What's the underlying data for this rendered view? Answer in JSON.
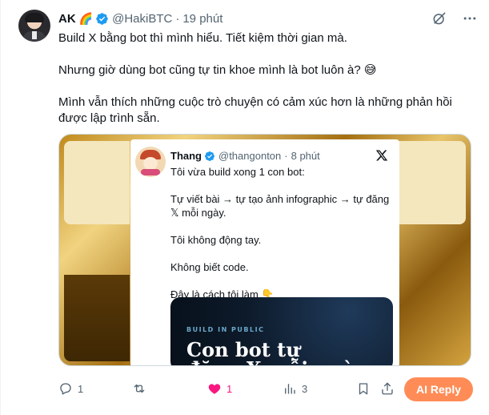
{
  "tweet": {
    "author_name": "AK",
    "author_emoji": "🌈",
    "handle": "@HakiBTC",
    "separator": "·",
    "time": "19 phút",
    "paragraphs": [
      "Build X bằng bot thì mình hiểu. Tiết kiệm thời gian mà.",
      "Nhưng giờ dùng bot cũng tự tin khoe mình là bot luôn à? 😅",
      "Mình vẫn thích những cuộc trò chuyện có cảm xúc hơn là những phản hồi được lập trình sẵn."
    ]
  },
  "quoted": {
    "author_name": "Thang",
    "handle": "@thangonton",
    "separator": "·",
    "time": "8 phút",
    "paragraphs": [
      "Tôi vừa build xong 1 con bot:",
      "Tự viết bài → tự tạo ảnh infographic → tự đăng 𝕏 mỗi ngày.",
      "Tôi không động tay.",
      "Không biết code.",
      "Đây là cách tôi làm 👇"
    ],
    "promo": {
      "eyebrow": "BUILD IN PUBLIC",
      "headline_line1": "Con bot tự",
      "headline_line2": "đăng X mỗi ngày"
    }
  },
  "actions": {
    "replies": "1",
    "reposts": "",
    "likes": "1",
    "views": "3",
    "ai_reply_label": "AI Reply"
  },
  "icons": {
    "grok": "grok-icon",
    "more": "more-icon",
    "verified": "verified-icon",
    "x_logo": "x-logo-icon",
    "reply": "reply-icon",
    "repost": "repost-icon",
    "like": "heart-icon",
    "views": "views-icon",
    "bookmark": "bookmark-icon",
    "share": "share-icon"
  },
  "colors": {
    "accent_blue": "#1d9bf0",
    "like_pink": "#f91880",
    "ai_button": "#ff8c57",
    "secondary_text": "#536471"
  }
}
